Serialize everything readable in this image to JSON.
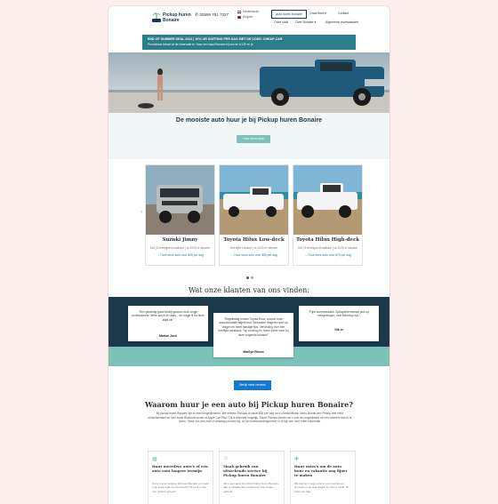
{
  "header": {
    "logo_line1": "Pickup huren",
    "logo_line2": "Bonaire",
    "phone": "00599 781 7327",
    "languages": [
      "Nederlands",
      "English"
    ],
    "nav_button": "auto huren bonaire",
    "nav_items": [
      "Onze fleet",
      "Contact",
      "Onze visie",
      "Over Bonaire",
      "Algemene voorwaarden"
    ]
  },
  "promo": {
    "line1": "END OF SUMMER DEAL 2022 | 10% OR KORTING PER DAG MET DE CODE: CHEAP-CAR",
    "line2": "Promotions betaal uit de reservatie te. Huur een kaart Bonaire bij ons en U-DE en je."
  },
  "hero": {
    "title": "De mooiste auto huur je bij Pickup huren Bonaire",
    "button": "Huur direct auto"
  },
  "cars": [
    {
      "name": "Suzuki Jimny",
      "desc": "4x4 | 5 terreigoed haalbaar | vk 2020 of nieuwer",
      "price": "→ Huur deze auto voor $45 per dag"
    },
    {
      "name": "Toyota Hilux Low-deck",
      "desc": "Heerlijke robuust | vk 2020 of nieuwer",
      "price": "→ Huur deze auto voor $55 per dag"
    },
    {
      "name": "Toyota Hilux High-deck",
      "desc": "4x4 | 5 terreigoed haalbaar | vk 2020 of nieuwer",
      "price": "→ Huur deze auto voor $75 per dag"
    }
  ],
  "reviews": {
    "title": "Wat onze klanten van ons vinden:",
    "items": [
      {
        "text": "\"Een geweldig goed bedrijf gewoon leuk zorgje professioneel. Nette auto's en alles... de volgje ik na deze altijd uit!\"",
        "author": "Marion Jock"
      },
      {
        "text": "\"Regelmatig reuzen Toyota Hilux, voorzie onze accommodatie afgeleverd. Bedanken reageren snel op vragen en heeft handige tips. Verbinding over een heerlijke aandacht. Top ervaring en huren zeker weer bij deze volgende bonaire!\"",
        "author": "Marilyn Rieum"
      },
      {
        "text": "\"Fijne communicatie. Spiksplinternieuwe pick up meegekregen, veel beleving! top.\"",
        "author": "Nik m"
      }
    ],
    "button": "Bekijk meer reviews"
  },
  "why": {
    "title": "Waarom huur je een auto bij Pickup huren Bonaire?",
    "text": "Bij pickup huren Bonaire zijn er veel mogelijkheden. We hebben Pickups al vanaf $55 per dag voor u beschikbaar. Met u Bonair een Pickup met extra tuinschimaldel en luxe zoals Bluetooth audio of Apple Car Play? Dit is allemaal mogelijk. Saoet Pickups bieden we u ook de mogelijkheid om een kleinere auto's te huren. Stuur ons een mail of whatsapp bericht bij, zo het beanwoordingermeer in of kijk one voor meer informatie.",
    "features": [
      {
        "title": "Huur meerdere auto's of een auto voor langere termijn",
        "text": "Komt u voor langere tijd naar Bonaire en zoekt u op zoek naar een huurauto? Of bent u met een grotere groep?"
      },
      {
        "title": "Maak gebruik van uitstekende service bij Pickup huren Bonaire",
        "text": "Als u een auto huurt bij Pickup huren Bonaire dan is uitstekende service het uiter beste gebruik."
      },
      {
        "title": "Huur extra's om de auto huur en vakantie nog fijner te maken",
        "text": "Wij kunnen zorgen dat er een snorkel en snorkels in de auto liggen en dat er zeker 35 extra per dag."
      }
    ]
  },
  "colors": {
    "teal": "#7cc2b8",
    "navy": "#1d3a4c",
    "blue": "#1677d2",
    "promo": "#2a7d8a"
  }
}
